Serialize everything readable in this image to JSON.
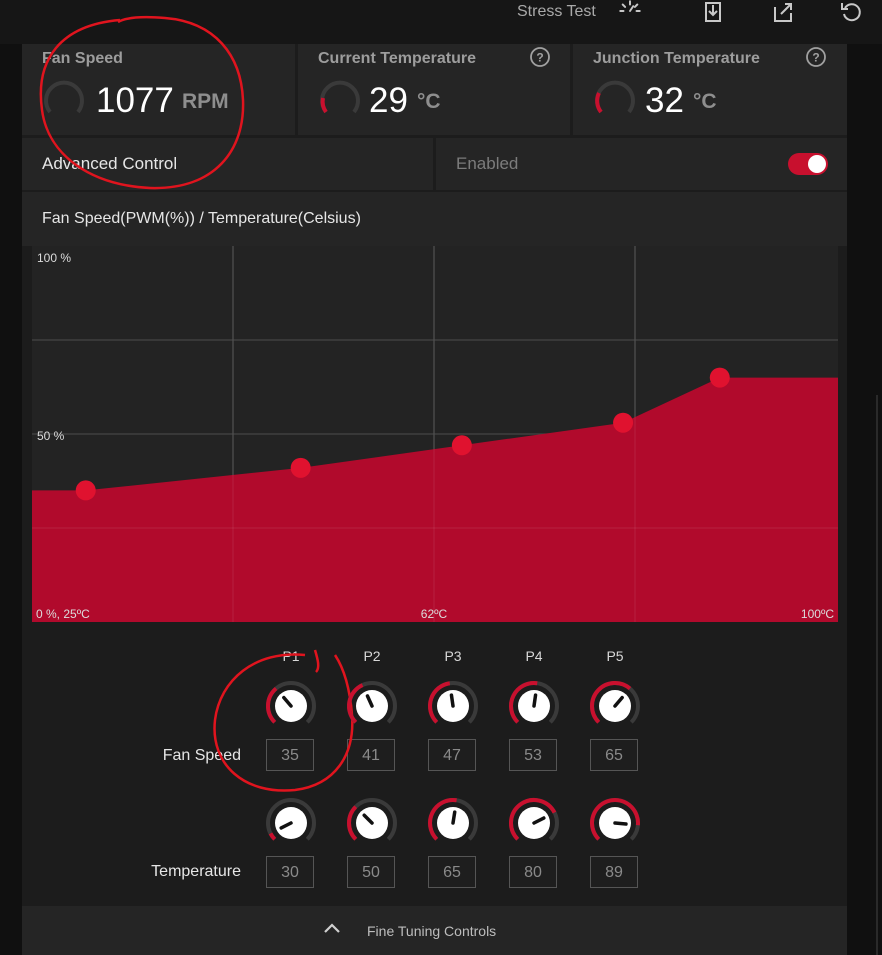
{
  "toolbar": {
    "stress_label": "Stress Test",
    "icons": [
      "speedometer-icon",
      "export-icon",
      "share-icon",
      "reset-icon"
    ]
  },
  "cards": [
    {
      "title": "Fan Speed",
      "value": "1077",
      "unit": "RPM",
      "gauge_fraction": 0.0
    },
    {
      "title": "Current Temperature",
      "value": "29",
      "unit": "°C",
      "gauge_fraction": 0.18
    },
    {
      "title": "Junction Temperature",
      "value": "32",
      "unit": "°C",
      "gauge_fraction": 0.22
    }
  ],
  "advanced": {
    "label": "Advanced Control",
    "state_label": "Enabled",
    "enabled": true
  },
  "chart_title": "Fan Speed(PWM(%)) / Temperature(Celsius)",
  "chart_data": {
    "type": "area",
    "title": "Fan Speed(PWM(%)) / Temperature(Celsius)",
    "x_unit": "°C",
    "y_unit": "%",
    "xlim": [
      25,
      100
    ],
    "ylim": [
      0,
      100
    ],
    "x_tick_labels": [
      "0 %, 25ºC",
      "62ºC",
      "100ºC"
    ],
    "y_tick_labels": [
      "100 %",
      "50 %"
    ],
    "points": [
      {
        "x": 30,
        "y": 35
      },
      {
        "x": 50,
        "y": 41
      },
      {
        "x": 65,
        "y": 47
      },
      {
        "x": 80,
        "y": 53
      },
      {
        "x": 89,
        "y": 65
      }
    ],
    "fill_color": "#b10a2c",
    "point_color": "#e0122f",
    "grid": true
  },
  "points_labels": [
    "P1",
    "P2",
    "P3",
    "P4",
    "P5"
  ],
  "fan_speed": {
    "label": "Fan Speed",
    "values": [
      "35",
      "41",
      "47",
      "53",
      "65"
    ]
  },
  "temperature": {
    "label": "Temperature",
    "values": [
      "30",
      "50",
      "65",
      "80",
      "89"
    ]
  },
  "fine_tuning_label": "Fine Tuning Controls",
  "colors": {
    "accent": "#c8102e",
    "background": "#1c1c1c",
    "card": "#252525"
  }
}
